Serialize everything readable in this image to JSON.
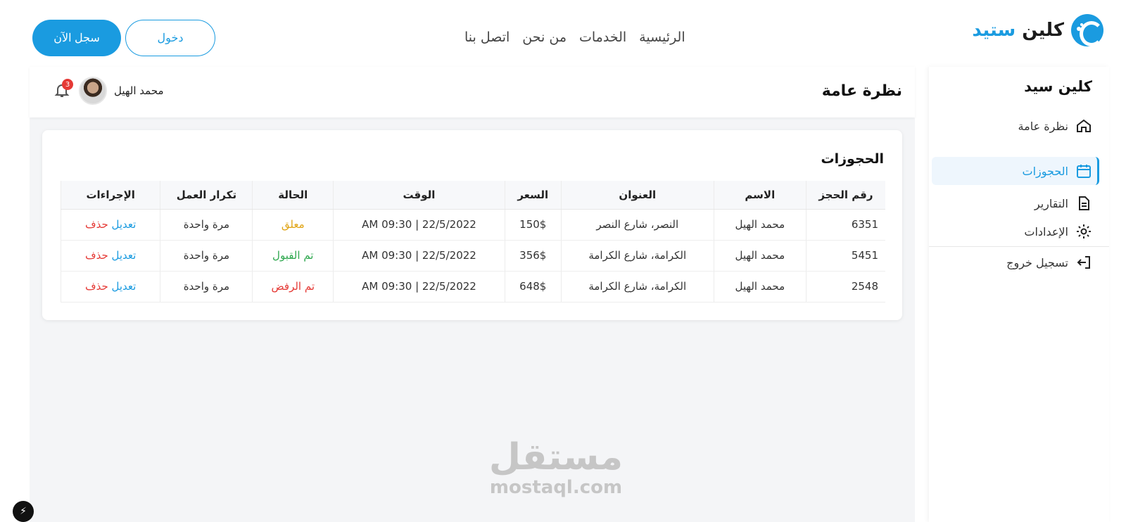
{
  "brand": {
    "name_part1": "كلين",
    "name_part2": "ستيد",
    "logo": "cleanstead-logo-icon"
  },
  "nav": {
    "items": [
      "الرئيسية",
      "الخدمات",
      "من نحن",
      "اتصل بنا"
    ]
  },
  "auth": {
    "login_label": "دخول",
    "register_label": "سجل الآن"
  },
  "sidebar": {
    "title": "كلين سيد",
    "items": [
      {
        "label": "نظرة عامة",
        "icon": "home-icon"
      },
      {
        "label": "الحجوزات",
        "icon": "calendar-icon"
      },
      {
        "label": "التقارير",
        "icon": "document-icon"
      },
      {
        "label": "الإعدادات",
        "icon": "gear-icon"
      },
      {
        "label": "تسجيل خروج",
        "icon": "logout-icon"
      }
    ]
  },
  "header": {
    "title": "نظرة عامة",
    "user_name": "محمد الهيل",
    "notification_count": "3"
  },
  "bookings": {
    "title": "الحجوزات",
    "columns": [
      "رقم الحجز",
      "الاسم",
      "العنوان",
      "السعر",
      "الوقت",
      "الحالة",
      "تكرار العمل",
      "الإجراءات"
    ],
    "edit_label": "تعديل",
    "delete_label": "حذف",
    "rows": [
      {
        "id": "6351",
        "name": "محمد الهيل",
        "address": "النصر، شارع النصر",
        "price": "150$",
        "time": "22/5/2022 | 09:30 AM",
        "status": "معلق",
        "frequency": "مرة واحدة"
      },
      {
        "id": "5451",
        "name": "محمد الهيل",
        "address": "الكرامة، شارع الكرامة",
        "price": "356$",
        "time": "22/5/2022 | 09:30 AM",
        "status": "تم القبول",
        "frequency": "مرة واحدة"
      },
      {
        "id": "2548",
        "name": "محمد الهيل",
        "address": "الكرامة، شارع الكرامة",
        "price": "648$",
        "time": "22/5/2022 | 09:30 AM",
        "status": "تم الرفض",
        "frequency": "مرة واحدة"
      }
    ]
  },
  "watermark": {
    "arabic": "مستقل",
    "latin": "mostaql.com"
  },
  "colors": {
    "accent": "#1a9be0",
    "pending": "#e0a415",
    "accepted": "#2fa84f",
    "rejected": "#e53935"
  }
}
